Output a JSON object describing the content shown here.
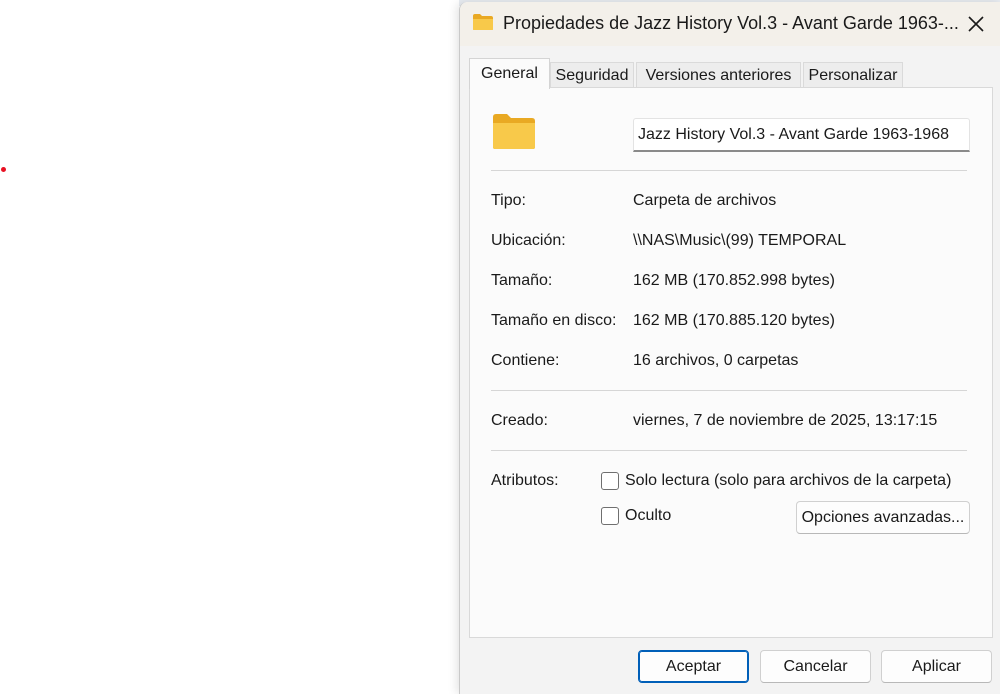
{
  "dialog": {
    "title": "Propiedades de Jazz History Vol.3 - Avant Garde 1963-...",
    "tabs": [
      {
        "label": "General"
      },
      {
        "label": "Seguridad"
      },
      {
        "label": "Versiones anteriores"
      },
      {
        "label": "Personalizar"
      }
    ],
    "name_value": "Jazz History Vol.3 - Avant Garde 1963-1968",
    "properties": [
      {
        "label": "Tipo:",
        "value": "Carpeta de archivos"
      },
      {
        "label": "Ubicación:",
        "value": "\\\\NAS\\Music\\(99) TEMPORAL"
      },
      {
        "label": "Tamaño:",
        "value": "162 MB (170.852.998 bytes)"
      },
      {
        "label": "Tamaño en disco:",
        "value": "162 MB (170.885.120 bytes)"
      },
      {
        "label": "Contiene:",
        "value": "16 archivos, 0 carpetas"
      }
    ],
    "created": {
      "label": "Creado:",
      "value": "viernes, 7 de noviembre de 2025, 13:17:15"
    },
    "attributes": {
      "label": "Atributos:",
      "readonly_label": "Solo lectura (solo para archivos de la carpeta)",
      "hidden_label": "Oculto",
      "advanced_label": "Opciones avanzadas..."
    },
    "buttons": {
      "ok": "Aceptar",
      "cancel": "Cancelar",
      "apply": "Aplicar"
    }
  },
  "icons": {
    "title": "folder-icon",
    "close": "close-icon",
    "large": "folder-icon"
  },
  "colors": {
    "accent": "#005fb8",
    "folder": "#f8c94a",
    "folder_dark": "#e9a923"
  }
}
